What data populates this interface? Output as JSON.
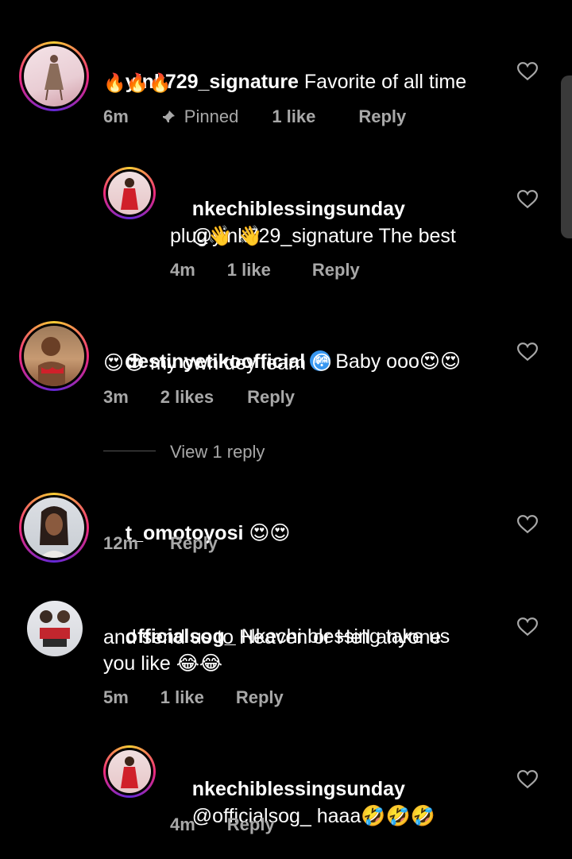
{
  "comments": [
    {
      "username": "yink729_signature",
      "text": " Favorite of all time",
      "line2": "🔥🔥🔥",
      "time": "6m",
      "pinned": "Pinned",
      "likes": "1 like",
      "reply": "Reply"
    },
    {
      "username": "nkechiblessingsunday",
      "mention": "@yink729_signature",
      "text": " The best",
      "line2": "plug👋 👋",
      "time": "4m",
      "likes": "1 like",
      "reply": "Reply"
    },
    {
      "username": "destinyetikoofficial",
      "text": "Baby ooo😍😍",
      "line2": "😍😍 my own dey learn 😳",
      "time": "3m",
      "likes": "2 likes",
      "reply": "Reply",
      "view_replies": "View 1 reply"
    },
    {
      "username": "t_omotoyosi",
      "text": " 😍😍",
      "time": "12m",
      "reply": "Reply"
    },
    {
      "username": "officialsog_",
      "text": " Nkechi blessing take us",
      "line2": "and send us to Heaven or Hell anyone",
      "line3": "you like 😂😂",
      "time": "5m",
      "likes": "1 like",
      "reply": "Reply"
    },
    {
      "username": "nkechiblessingsunday",
      "mention": "@officialsog_",
      "text": " haaa🤣🤣🤣",
      "time": "4m",
      "reply": "Reply"
    }
  ],
  "icons": {
    "heart": "heart-outline-icon",
    "pin": "pin-icon",
    "verified": "verified-badge-icon"
  },
  "colors": {
    "background": "#000000",
    "secondary_text": "#a8a8a8",
    "verified": "#3897f0"
  }
}
